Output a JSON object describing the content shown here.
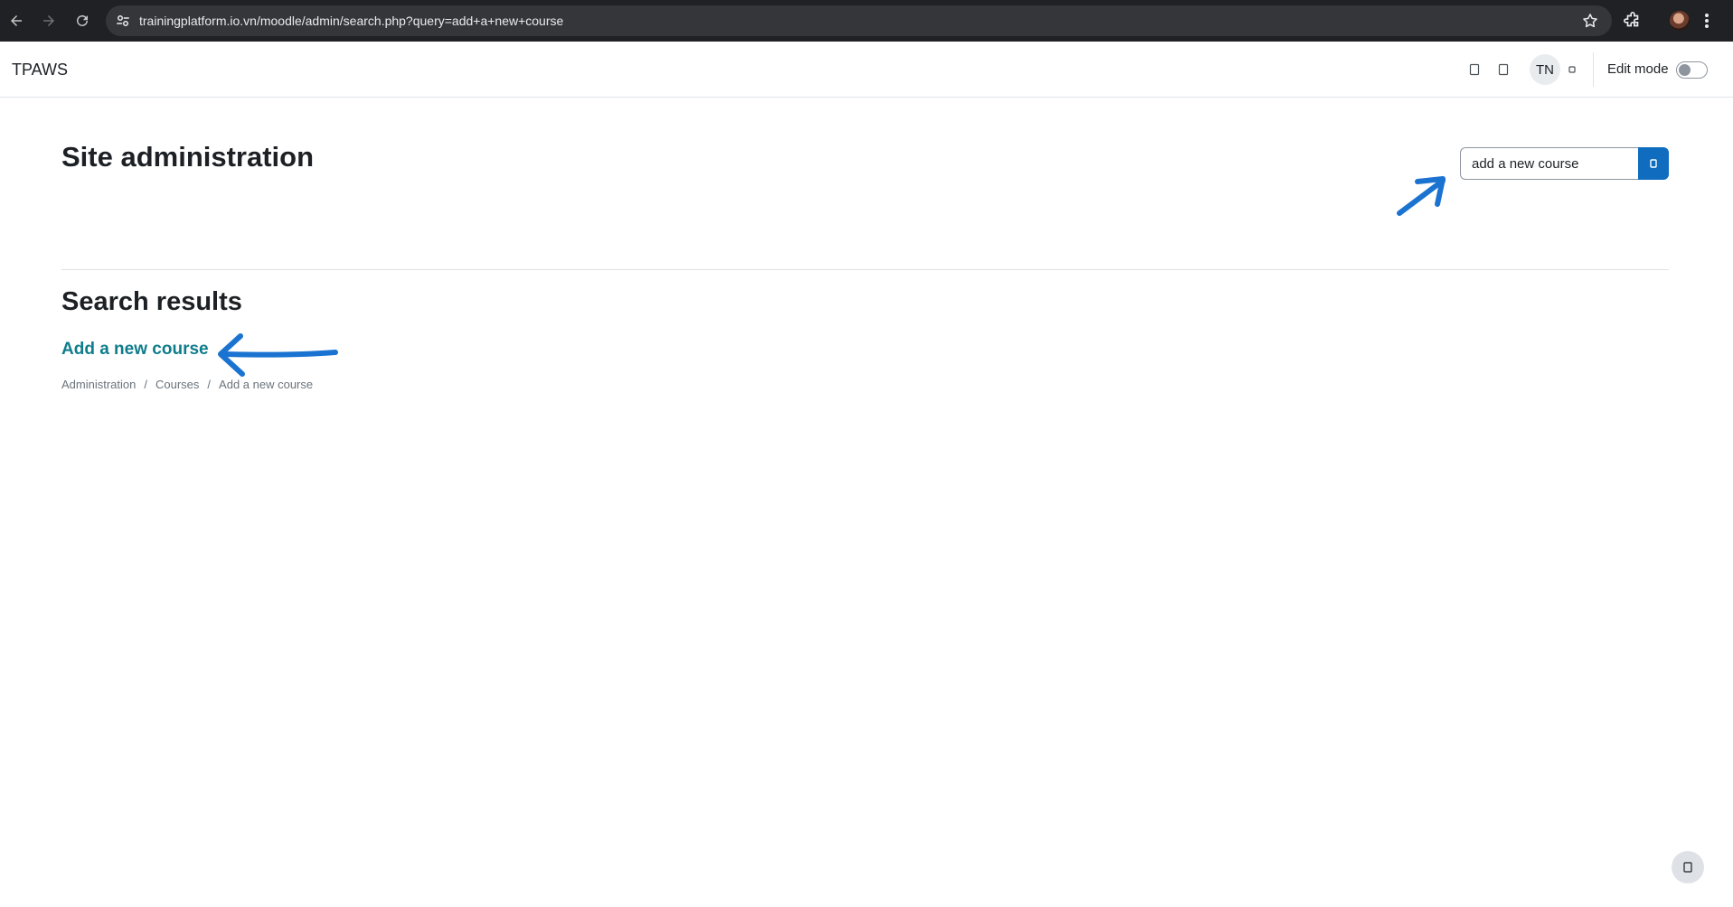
{
  "browser": {
    "url": "trainingplatform.io.vn/moodle/admin/search.php?query=add+a+new+course",
    "icons": {
      "back": "arrow-left-icon",
      "forward": "arrow-right-icon",
      "reload": "reload-icon",
      "site_settings": "tune-icon",
      "bookmark": "star-icon",
      "extensions": "puzzle-icon",
      "profile": "profile-avatar",
      "menu": "kebab-menu-icon"
    }
  },
  "navbar": {
    "brand": "TPAWS",
    "avatar_initials": "TN",
    "edit_mode_label": "Edit mode",
    "edit_mode_on": false,
    "icons": {
      "notifications": "bell-icon",
      "messages": "chat-icon",
      "user_menu": "caret-down-icon"
    }
  },
  "main": {
    "title": "Site administration",
    "search": {
      "value": "add a new course",
      "button_icon": "search-icon"
    },
    "results_heading": "Search results",
    "results": [
      {
        "title": "Add a new course",
        "breadcrumb": [
          "Administration",
          "Courses",
          "Add a new course"
        ]
      }
    ],
    "breadcrumb_separator": "/"
  },
  "footer": {
    "help_icon": "question-icon"
  },
  "colors": {
    "chrome_bg": "#202124",
    "url_pill_bg": "#35363a",
    "primary": "#0f6cbf",
    "link": "#0f7c8c",
    "annotation_arrow": "#1a73d0",
    "muted_text": "#6a737b"
  }
}
